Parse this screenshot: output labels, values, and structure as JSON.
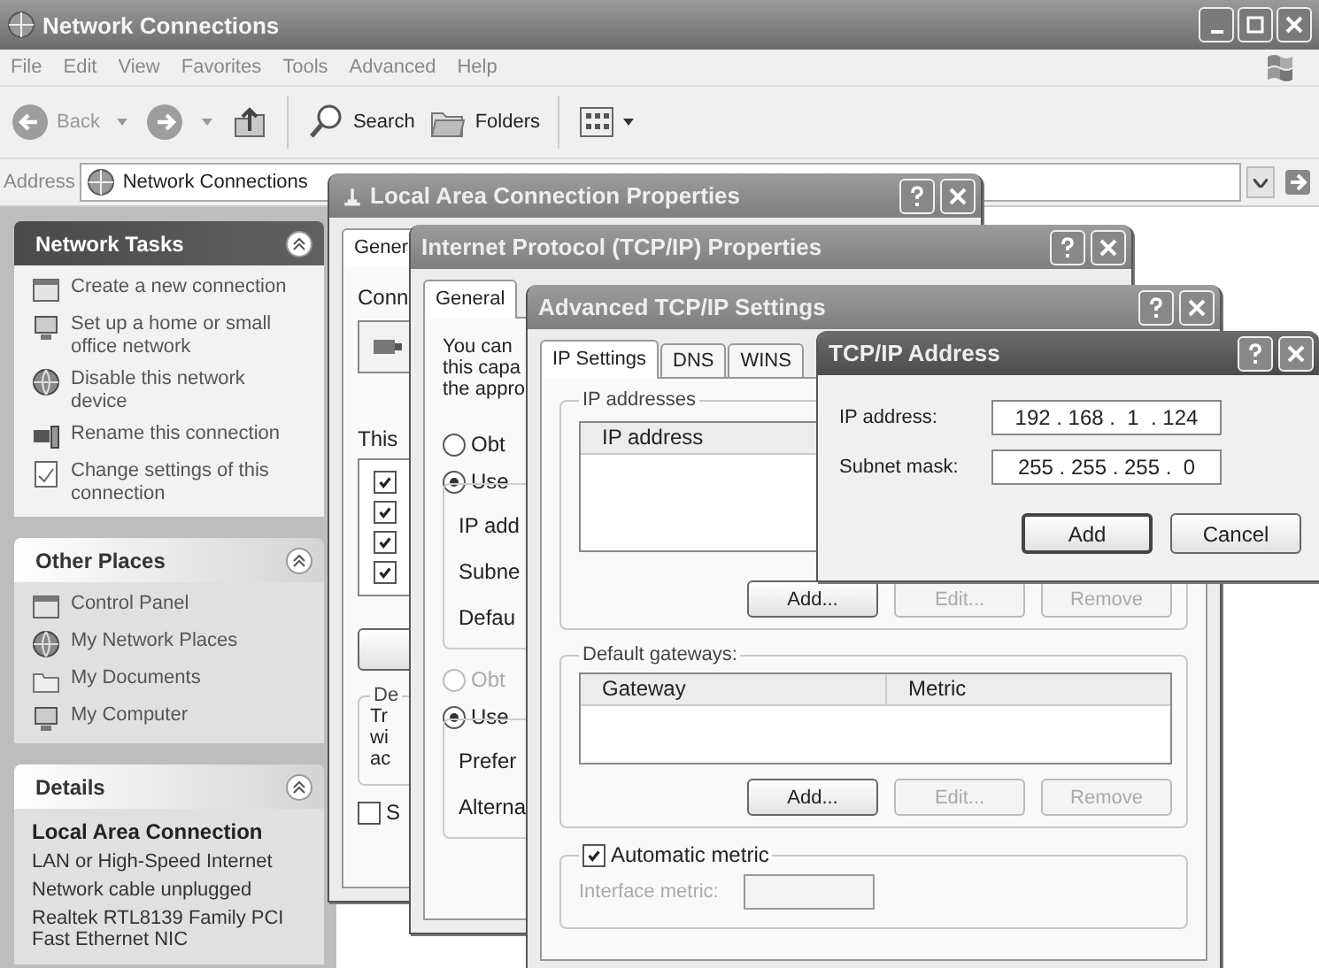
{
  "explorer": {
    "title": "Network Connections",
    "menu": [
      "File",
      "Edit",
      "View",
      "Favorites",
      "Tools",
      "Advanced",
      "Help"
    ],
    "toolbar": {
      "back": "Back",
      "search": "Search",
      "folders": "Folders"
    },
    "address": {
      "label": "Address",
      "value": "Network Connections"
    },
    "panels": [
      {
        "title": "Network Tasks",
        "items": [
          "Create a new connection",
          "Set up a home or small office network",
          "Disable this network device",
          "Rename this connection",
          "Change settings of this connection"
        ]
      },
      {
        "title": "Other Places",
        "items": [
          "Control Panel",
          "My Network Places",
          "My Documents",
          "My Computer"
        ]
      }
    ],
    "details": {
      "title": "Details",
      "heading": "Local Area Connection",
      "lines": [
        "LAN or High-Speed Internet",
        "Network cable unplugged",
        "Realtek RTL8139 Family PCI Fast Ethernet NIC"
      ]
    }
  },
  "lan_properties": {
    "title": "Local Area Connection Properties",
    "active": false,
    "tab": {
      "label": "Gener",
      "selected": true
    },
    "connect_label": "Conn",
    "components_label": "This",
    "components": [
      {
        "checked": true
      },
      {
        "checked": true
      },
      {
        "checked": true
      },
      {
        "checked": true
      }
    ],
    "description_label": "De",
    "description_lines": [
      "Tr",
      "wi",
      "ac"
    ],
    "show_icon": {
      "label": "S",
      "checked": false
    }
  },
  "tcpip_properties": {
    "title": "Internet Protocol (TCP/IP) Properties",
    "active": false,
    "tab": {
      "label": "General",
      "selected": true
    },
    "intro_lines": [
      "You can",
      "this capa",
      "the appro"
    ],
    "ip_options": [
      {
        "label": "Obt",
        "selected": false,
        "disabled": false
      },
      {
        "label": "Use",
        "selected": true,
        "disabled": false
      }
    ],
    "ip_fields": [
      "IP add",
      "Subne",
      "Defau"
    ],
    "dns_options": [
      {
        "label": "Obt",
        "selected": false,
        "disabled": true
      },
      {
        "label": "Use",
        "selected": true,
        "disabled": false
      }
    ],
    "dns_fields": [
      "Prefer",
      "Alterna"
    ]
  },
  "advanced": {
    "title": "Advanced TCP/IP Settings",
    "active": false,
    "tabs": [
      {
        "label": "IP Settings",
        "selected": true
      },
      {
        "label": "DNS",
        "selected": false
      },
      {
        "label": "WINS",
        "selected": false
      }
    ],
    "ip_group": {
      "label": "IP addresses",
      "columns": [
        "IP address"
      ],
      "buttons": [
        {
          "label": "Add...",
          "disabled": false
        },
        {
          "label": "Edit...",
          "disabled": true
        },
        {
          "label": "Remove",
          "disabled": true
        }
      ]
    },
    "gateway_group": {
      "label": "Default gateways:",
      "columns": [
        "Gateway",
        "Metric"
      ],
      "buttons": [
        {
          "label": "Add...",
          "disabled": false
        },
        {
          "label": "Edit...",
          "disabled": true
        },
        {
          "label": "Remove",
          "disabled": true
        }
      ]
    },
    "metric": {
      "label": "Automatic metric",
      "checked": true,
      "field_label": "Interface metric:",
      "disabled": true
    }
  },
  "address_dialog": {
    "title": "TCP/IP Address",
    "active": true,
    "fields": [
      {
        "label": "IP address:",
        "value": "192 . 168 .  1  . 124"
      },
      {
        "label": "Subnet mask:",
        "value": "255 . 255 . 255 .  0"
      }
    ],
    "buttons": [
      {
        "label": "Add",
        "default": true
      },
      {
        "label": "Cancel",
        "default": false
      }
    ]
  }
}
